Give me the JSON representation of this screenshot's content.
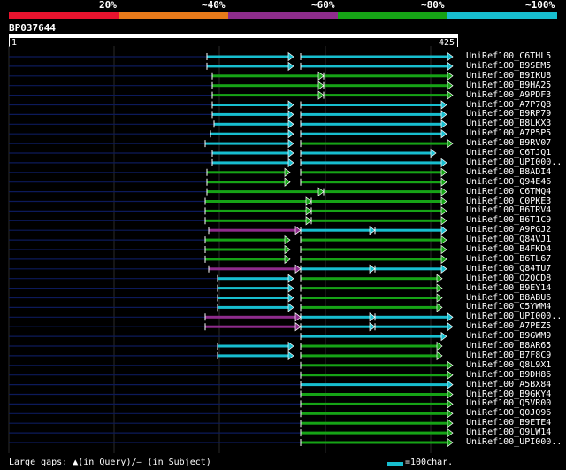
{
  "legend_top": {
    "labels": [
      "20%",
      "~40%",
      "~60%",
      "~80%",
      "~100%"
    ],
    "colors": [
      "#e8132e",
      "#e87a1a",
      "#8e2c8c",
      "#16a316",
      "#17becf"
    ]
  },
  "query": {
    "id": "BP037644",
    "start": "1",
    "end": "425"
  },
  "hits": [
    {
      "label": "UniRef100_C6THL5",
      "segs": [
        [
          234,
          332,
          "c"
        ],
        [
          340,
          512,
          "c"
        ]
      ]
    },
    {
      "label": "UniRef100_B9SEM5",
      "segs": [
        [
          234,
          332,
          "c"
        ],
        [
          340,
          512,
          "c"
        ]
      ]
    },
    {
      "label": "UniRef100_B9IKU8",
      "segs": [
        [
          240,
          366,
          "g"
        ],
        [
          366,
          512,
          "g"
        ]
      ]
    },
    {
      "label": "UniRef100_B9HA25",
      "segs": [
        [
          240,
          366,
          "g"
        ],
        [
          366,
          512,
          "g"
        ]
      ]
    },
    {
      "label": "UniRef100_A9PDF3",
      "segs": [
        [
          240,
          366,
          "g"
        ],
        [
          366,
          512,
          "g"
        ]
      ]
    },
    {
      "label": "UniRef100_A7P7Q8",
      "segs": [
        [
          240,
          332,
          "c"
        ],
        [
          340,
          505,
          "c"
        ]
      ]
    },
    {
      "label": "UniRef100_B9RP79",
      "segs": [
        [
          240,
          332,
          "c"
        ],
        [
          340,
          505,
          "c"
        ]
      ]
    },
    {
      "label": "UniRef100_B8LKX3",
      "segs": [
        [
          242,
          332,
          "c"
        ],
        [
          340,
          505,
          "c"
        ]
      ]
    },
    {
      "label": "UniRef100_A7P5P5",
      "segs": [
        [
          238,
          332,
          "c"
        ],
        [
          340,
          505,
          "c"
        ]
      ]
    },
    {
      "label": "UniRef100_B9RV07",
      "segs": [
        [
          232,
          332,
          "c"
        ],
        [
          340,
          512,
          "g"
        ]
      ]
    },
    {
      "label": "UniRef100_C6TJQ1",
      "segs": [
        [
          240,
          332,
          "c"
        ],
        [
          340,
          493,
          "c"
        ]
      ]
    },
    {
      "label": "UniRef100_UPI000..",
      "segs": [
        [
          240,
          332,
          "c"
        ],
        [
          340,
          505,
          "c"
        ]
      ]
    },
    {
      "label": "UniRef100_B8ADI4",
      "segs": [
        [
          234,
          328,
          "g"
        ],
        [
          340,
          505,
          "g"
        ]
      ]
    },
    {
      "label": "UniRef100_Q94E46",
      "segs": [
        [
          234,
          328,
          "g"
        ],
        [
          340,
          505,
          "g"
        ]
      ]
    },
    {
      "label": "UniRef100_C6TMQ4",
      "segs": [
        [
          234,
          366,
          "g"
        ],
        [
          366,
          505,
          "g"
        ]
      ]
    },
    {
      "label": "UniRef100_C0PKE3",
      "segs": [
        [
          232,
          352,
          "g"
        ],
        [
          352,
          505,
          "g"
        ]
      ]
    },
    {
      "label": "UniRef100_B6TRV4",
      "segs": [
        [
          232,
          352,
          "g"
        ],
        [
          352,
          505,
          "g"
        ]
      ]
    },
    {
      "label": "UniRef100_B6T1C9",
      "segs": [
        [
          232,
          352,
          "g"
        ],
        [
          352,
          505,
          "g"
        ]
      ]
    },
    {
      "label": "UniRef100_A9PGJ2",
      "segs": [
        [
          236,
          340,
          "p"
        ],
        [
          340,
          424,
          "c"
        ],
        [
          424,
          505,
          "c"
        ]
      ]
    },
    {
      "label": "UniRef100_Q84VJ1",
      "segs": [
        [
          232,
          328,
          "g"
        ],
        [
          340,
          505,
          "g"
        ]
      ]
    },
    {
      "label": "UniRef100_B4FKD4",
      "segs": [
        [
          232,
          328,
          "g"
        ],
        [
          340,
          505,
          "g"
        ]
      ]
    },
    {
      "label": "UniRef100_B6TL67",
      "segs": [
        [
          232,
          328,
          "g"
        ],
        [
          340,
          505,
          "g"
        ]
      ]
    },
    {
      "label": "UniRef100_Q84TU7",
      "segs": [
        [
          236,
          340,
          "p"
        ],
        [
          340,
          424,
          "c"
        ],
        [
          424,
          505,
          "c"
        ]
      ]
    },
    {
      "label": "UniRef100_Q2QCD8",
      "segs": [
        [
          246,
          332,
          "c"
        ],
        [
          340,
          500,
          "g"
        ]
      ]
    },
    {
      "label": "UniRef100_B9EY14",
      "segs": [
        [
          246,
          332,
          "c"
        ],
        [
          340,
          500,
          "g"
        ]
      ]
    },
    {
      "label": "UniRef100_B8ABU6",
      "segs": [
        [
          246,
          332,
          "c"
        ],
        [
          340,
          500,
          "g"
        ]
      ]
    },
    {
      "label": "UniRef100_C5YWM4",
      "segs": [
        [
          246,
          332,
          "c"
        ],
        [
          340,
          500,
          "g"
        ]
      ]
    },
    {
      "label": "UniRef100_UPI000..",
      "segs": [
        [
          232,
          340,
          "p"
        ],
        [
          340,
          424,
          "c"
        ],
        [
          424,
          512,
          "c"
        ]
      ]
    },
    {
      "label": "UniRef100_A7PEZ5",
      "segs": [
        [
          232,
          340,
          "p"
        ],
        [
          340,
          424,
          "c"
        ],
        [
          424,
          512,
          "c"
        ]
      ]
    },
    {
      "label": "UniRef100_B9GWM9",
      "segs": [
        [
          340,
          505,
          "c"
        ]
      ]
    },
    {
      "label": "UniRef100_B8AR65",
      "segs": [
        [
          246,
          332,
          "c"
        ],
        [
          340,
          500,
          "g"
        ]
      ]
    },
    {
      "label": "UniRef100_B7F8C9",
      "segs": [
        [
          246,
          332,
          "c"
        ],
        [
          340,
          500,
          "g"
        ]
      ]
    },
    {
      "label": "UniRef100_Q8L9X1",
      "segs": [
        [
          340,
          512,
          "g"
        ]
      ]
    },
    {
      "label": "UniRef100_B9DH86",
      "segs": [
        [
          340,
          512,
          "g"
        ]
      ]
    },
    {
      "label": "UniRef100_A5BX84",
      "segs": [
        [
          340,
          512,
          "c"
        ]
      ]
    },
    {
      "label": "UniRef100_B9GKY4",
      "segs": [
        [
          340,
          512,
          "g"
        ]
      ]
    },
    {
      "label": "UniRef100_Q5VR00",
      "segs": [
        [
          340,
          512,
          "g"
        ]
      ]
    },
    {
      "label": "UniRef100_Q0JQ96",
      "segs": [
        [
          340,
          512,
          "g"
        ]
      ]
    },
    {
      "label": "UniRef100_B9ETE4",
      "segs": [
        [
          340,
          512,
          "g"
        ]
      ]
    },
    {
      "label": "UniRef100_Q9LW14",
      "segs": [
        [
          340,
          512,
          "g"
        ]
      ]
    },
    {
      "label": "UniRef100_UPI000..",
      "segs": [
        [
          340,
          512,
          "g"
        ]
      ]
    }
  ],
  "legend_bottom": {
    "gaps_text": "Large gaps: ▲(in Query)/– (in Subject)",
    "scale_text": "=100char."
  }
}
